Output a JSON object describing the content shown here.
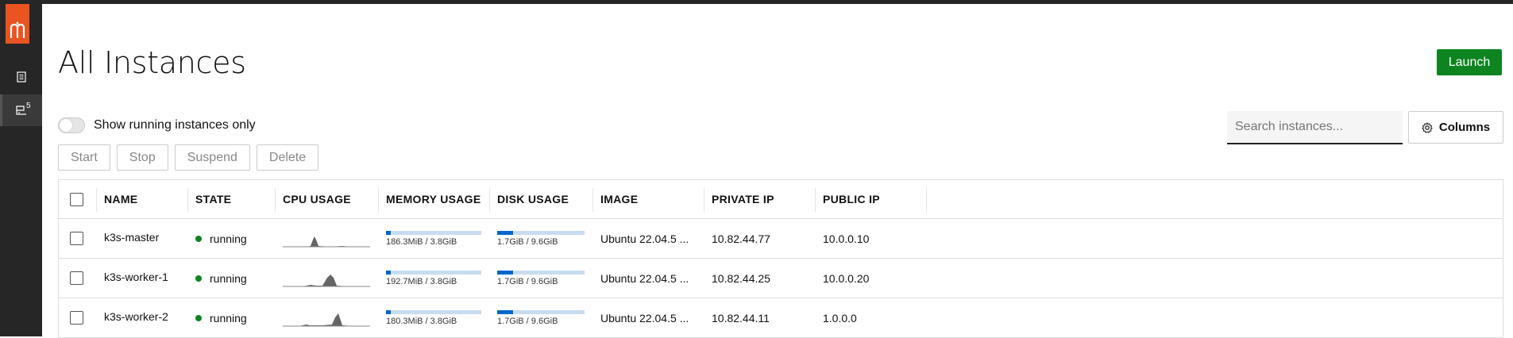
{
  "sidebar": {
    "logo_text": "m",
    "instances_badge": "5"
  },
  "header": {
    "title": "All Instances",
    "launch_label": "Launch"
  },
  "filters": {
    "toggle_label": "Show running instances only",
    "search_placeholder": "Search instances...",
    "columns_label": "Columns"
  },
  "actions": {
    "start": "Start",
    "stop": "Stop",
    "suspend": "Suspend",
    "delete": "Delete"
  },
  "table": {
    "columns": [
      "NAME",
      "STATE",
      "CPU USAGE",
      "MEMORY USAGE",
      "DISK USAGE",
      "IMAGE",
      "PRIVATE IP",
      "PUBLIC IP"
    ],
    "rows": [
      {
        "name": "k3s-master",
        "state": "running",
        "memory": "186.3MiB / 3.8GiB",
        "memory_fraction": 0.05,
        "disk": "1.7GiB / 9.6GiB",
        "disk_fraction": 0.18,
        "image": "Ubuntu 22.04.5 ...",
        "private_ip": "10.82.44.77",
        "public_ip": "10.0.0.10"
      },
      {
        "name": "k3s-worker-1",
        "state": "running",
        "memory": "192.7MiB / 3.8GiB",
        "memory_fraction": 0.05,
        "disk": "1.7GiB / 9.6GiB",
        "disk_fraction": 0.18,
        "image": "Ubuntu 22.04.5 ...",
        "private_ip": "10.82.44.25",
        "public_ip": "10.0.0.20"
      },
      {
        "name": "k3s-worker-2",
        "state": "running",
        "memory": "180.3MiB / 3.8GiB",
        "memory_fraction": 0.05,
        "disk": "1.7GiB / 9.6GiB",
        "disk_fraction": 0.18,
        "image": "Ubuntu 22.04.5 ...",
        "private_ip": "10.82.44.11",
        "public_ip": "1.0.0.0"
      }
    ]
  },
  "colors": {
    "brand": "#e95420",
    "launch": "#0e8420",
    "running": "#0e8420",
    "meter_fill": "#0066cc"
  }
}
